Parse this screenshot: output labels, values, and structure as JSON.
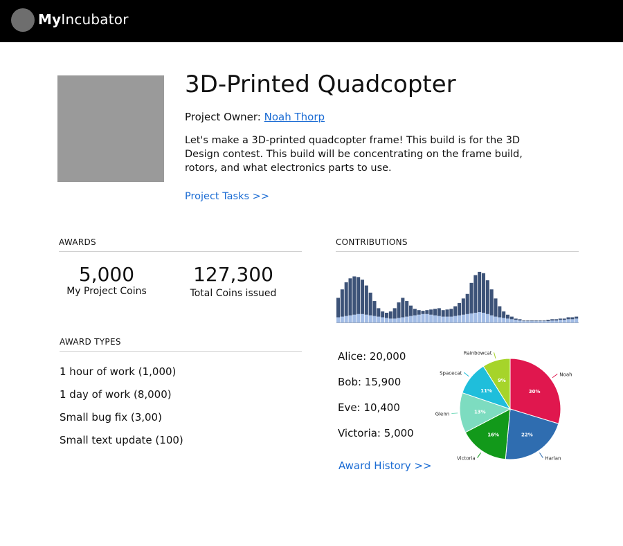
{
  "app": {
    "brand_bold": "My",
    "brand_rest": "Incubator"
  },
  "project": {
    "title": "3D-Printed Quadcopter",
    "owner_label": "Project Owner:",
    "owner_name": "Noah Thorp",
    "description": "Let's make a 3D-printed quadcopter frame! This build is for the 3D Design contest. This build will be concentrating on the frame build, rotors, and what electronics parts to use.",
    "tasks_link": "Project Tasks >>"
  },
  "awards": {
    "heading": "AWARDS",
    "my_coins_value": "5,000",
    "my_coins_label": "My Project Coins",
    "total_coins_value": "127,300",
    "total_coins_label": "Total Coins issued"
  },
  "award_types": {
    "heading": "AWARD TYPES",
    "items": [
      "1 hour of work (1,000)",
      "1 day of work (8,000)",
      "Small bug fix (3,00)",
      "Small text update (100)"
    ]
  },
  "contributions": {
    "heading": "CONTRIBUTIONS",
    "leaders": [
      "Alice: 20,000",
      "Bob: 15,900",
      "Eve: 10,400",
      "Victoria: 5,000"
    ],
    "history_link": "Award History >>"
  },
  "colors": {
    "accent": "#1a6bd3",
    "topbar": "#000000",
    "bar_dark": "#3d5378",
    "bar_light": "#a3bde6"
  },
  "chart_data": [
    {
      "type": "bar",
      "stacked": true,
      "series": [
        {
          "values": [
            8,
            9,
            10,
            11,
            12,
            13,
            13,
            12,
            11,
            10,
            9,
            8,
            7,
            6,
            6,
            7,
            8,
            9,
            10,
            11,
            12,
            13,
            13,
            12,
            11,
            10,
            9,
            9,
            9,
            10,
            11,
            12,
            13,
            14,
            15,
            16,
            15,
            13,
            11,
            9,
            8,
            7,
            6,
            5,
            4,
            3,
            2,
            2,
            2,
            2,
            2,
            2,
            2,
            3,
            3,
            4,
            4,
            5,
            5,
            6
          ]
        },
        {
          "values": [
            30,
            42,
            52,
            57,
            59,
            57,
            53,
            45,
            35,
            23,
            13,
            9,
            8,
            11,
            16,
            24,
            30,
            24,
            16,
            10,
            7,
            5,
            6,
            8,
            10,
            12,
            10,
            11,
            12,
            15,
            19,
            25,
            31,
            47,
            58,
            62,
            61,
            52,
            40,
            28,
            17,
            10,
            6,
            4,
            2,
            2,
            1,
            1,
            1,
            1,
            1,
            1,
            2,
            2,
            2,
            2,
            2,
            3,
            3,
            3
          ]
        }
      ]
    },
    {
      "type": "pie",
      "labels": [
        "Noah",
        "Harlan",
        "Victoria",
        "Glenn",
        "Spacecat",
        "Rainbowcat"
      ],
      "values": [
        30,
        22,
        16,
        13,
        11,
        9
      ],
      "slice_labels": [
        "30%",
        "22%",
        "16%",
        "13%",
        "11%",
        "9%"
      ],
      "colors": [
        "#e0174e",
        "#2f6db0",
        "#12991a",
        "#7ddcc0",
        "#1fbedb",
        "#a6d42a"
      ]
    }
  ]
}
